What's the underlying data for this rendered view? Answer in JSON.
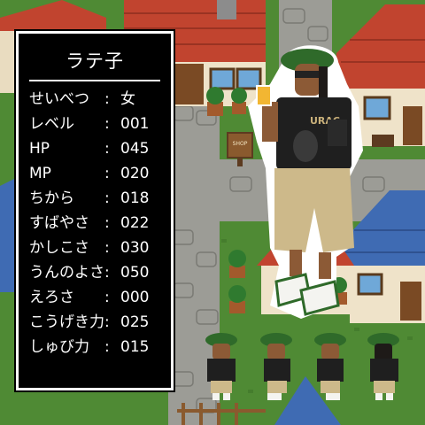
{
  "status": {
    "name": "ラテ子",
    "separator": ":",
    "rows": [
      {
        "label": "せいべつ",
        "value": "女"
      },
      {
        "label": "レベル",
        "value": "001"
      },
      {
        "label": "HP",
        "value": "045"
      },
      {
        "label": "MP",
        "value": "020"
      },
      {
        "label": "ちから",
        "value": "018"
      },
      {
        "label": "すばやさ",
        "value": "022"
      },
      {
        "label": "かしこさ",
        "value": "030"
      },
      {
        "label": "うんのよさ",
        "value": "050"
      },
      {
        "label": "えろさ",
        "value": "000"
      },
      {
        "label": "こうげき力",
        "value": "025"
      },
      {
        "label": "しゅび力",
        "value": "015"
      }
    ]
  },
  "scene": {
    "shop_sign": "SHOP",
    "shirt_text": "URAC",
    "colors": {
      "grass": "#4f8a34",
      "path_stone": "#9c9c96",
      "roof_red": "#c1442f",
      "roof_blue": "#3f6bb3",
      "beret_green": "#2f6a2a",
      "window_bg": "#000000",
      "window_text": "#ffffff"
    }
  },
  "sprite_views": [
    "front",
    "left",
    "right",
    "back"
  ]
}
